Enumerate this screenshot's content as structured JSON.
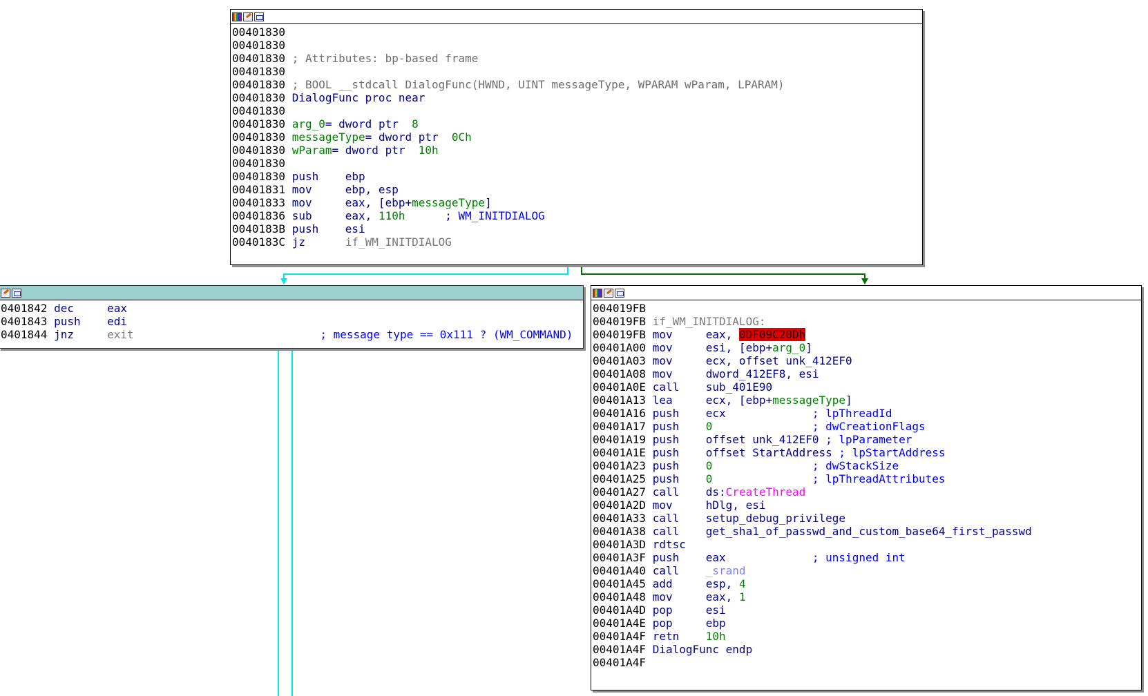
{
  "edge_colors": {
    "false_branch": "#00e5ee",
    "true_branch": "#007000"
  },
  "titlebar_icons": [
    "color-palette-icon",
    "edit-node-icon",
    "graph-view-icon"
  ],
  "node_main": {
    "lines": [
      {
        "addr": "00401830"
      },
      {
        "addr": "00401830"
      },
      {
        "addr": "00401830",
        "comment": "; Attributes: bp-based frame"
      },
      {
        "addr": "00401830"
      },
      {
        "addr": "00401830",
        "comment": "; BOOL __stdcall DialogFunc(HWND, UINT messageType, WPARAM wParam, LPARAM)"
      },
      {
        "addr": "00401830",
        "name": "DialogFunc",
        "rest": " proc near"
      },
      {
        "addr": "00401830"
      },
      {
        "addr": "00401830",
        "var": "arg_0",
        "op": "= dword ptr  ",
        "num": "8"
      },
      {
        "addr": "00401830",
        "var": "messageType",
        "op": "= dword ptr  ",
        "num": "0Ch"
      },
      {
        "addr": "00401830",
        "var": "wParam",
        "op": "= dword ptr  ",
        "num": "10h"
      },
      {
        "addr": "00401830"
      },
      {
        "addr": "00401830",
        "mn": "push",
        "ops": "ebp"
      },
      {
        "addr": "00401831",
        "mn": "mov",
        "ops": "ebp, esp"
      },
      {
        "addr": "00401833",
        "mn": "mov",
        "ops_a": "eax, [ebp+",
        "ops_var": "messageType",
        "ops_b": "]"
      },
      {
        "addr": "00401836",
        "mn": "sub",
        "ops_a": "eax, ",
        "ops_num": "110h",
        "bcomment": "; WM_INITDIALOG"
      },
      {
        "addr": "0040183B",
        "mn": "push",
        "ops": "esi"
      },
      {
        "addr": "0040183C",
        "mn": "jz",
        "label": "if_WM_INITDIALOG"
      }
    ]
  },
  "node_left": {
    "lines": [
      {
        "addr": "0401842",
        "mn": "dec",
        "ops": "eax"
      },
      {
        "addr": "0401843",
        "mn": "push",
        "ops": "edi"
      },
      {
        "addr": "0401844",
        "mn": "jnz",
        "label": "exit",
        "bcomment": "; message type == 0x111 ? (WM_COMMAND)"
      }
    ]
  },
  "node_right": {
    "lines": [
      {
        "addr": "004019FB"
      },
      {
        "addr": "004019FB",
        "labeldef": "if_WM_INITDIALOG:"
      },
      {
        "addr": "004019FB",
        "mn": "mov",
        "ops_a": "eax, ",
        "hl": "0DF09C20Dh"
      },
      {
        "addr": "00401A00",
        "mn": "mov",
        "ops_a": "esi, [ebp+",
        "ops_var": "arg_0",
        "ops_b": "]"
      },
      {
        "addr": "00401A03",
        "mn": "mov",
        "ops": "ecx, offset unk_412EF0"
      },
      {
        "addr": "00401A08",
        "mn": "mov",
        "ops": "dword_412EF8, esi"
      },
      {
        "addr": "00401A0E",
        "mn": "call",
        "ops": "sub_401E90"
      },
      {
        "addr": "00401A13",
        "mn": "lea",
        "ops_a": "ecx, [ebp+",
        "ops_var": "messageType",
        "ops_b": "]"
      },
      {
        "addr": "00401A16",
        "mn": "push",
        "ops": "ecx             ",
        "bcomment": "; lpThreadId"
      },
      {
        "addr": "00401A17",
        "mn": "push",
        "ops_num": "0",
        "ops_pad": "               ",
        "bcomment": "; dwCreationFlags"
      },
      {
        "addr": "00401A19",
        "mn": "push",
        "ops": "offset unk_412EF0 ",
        "bcomment": "; lpParameter"
      },
      {
        "addr": "00401A1E",
        "mn": "push",
        "ops": "offset StartAddress ",
        "bcomment": "; lpStartAddress"
      },
      {
        "addr": "00401A23",
        "mn": "push",
        "ops_num": "0",
        "ops_pad": "               ",
        "bcomment": "; dwStackSize"
      },
      {
        "addr": "00401A25",
        "mn": "push",
        "ops_num": "0",
        "ops_pad": "               ",
        "bcomment": "; lpThreadAttributes"
      },
      {
        "addr": "00401A27",
        "mn": "call",
        "ops_a": "ds:",
        "import": "CreateThread"
      },
      {
        "addr": "00401A2D",
        "mn": "mov",
        "ops": "hDlg, esi"
      },
      {
        "addr": "00401A33",
        "mn": "call",
        "bname": "setup_debug_privilege"
      },
      {
        "addr": "00401A38",
        "mn": "call",
        "bname": "get_sha1_of_passwd_and_custom_base64_first_passwd"
      },
      {
        "addr": "00401A3D",
        "mn": "rdtsc"
      },
      {
        "addr": "00401A3F",
        "mn": "push",
        "ops": "eax             ",
        "bcomment": "; unsigned int"
      },
      {
        "addr": "00401A40",
        "mn": "call",
        "lib": "_srand"
      },
      {
        "addr": "00401A45",
        "mn": "add",
        "ops_a": "esp, ",
        "ops_num": "4"
      },
      {
        "addr": "00401A48",
        "mn": "mov",
        "ops_a": "eax, ",
        "ops_num": "1"
      },
      {
        "addr": "00401A4D",
        "mn": "pop",
        "ops": "esi"
      },
      {
        "addr": "00401A4E",
        "mn": "pop",
        "ops": "ebp"
      },
      {
        "addr": "00401A4F",
        "mn": "retn",
        "ops_num": "10h"
      },
      {
        "addr": "00401A4F",
        "name": "DialogFunc",
        "rest": " endp"
      },
      {
        "addr": "00401A4F"
      }
    ]
  }
}
